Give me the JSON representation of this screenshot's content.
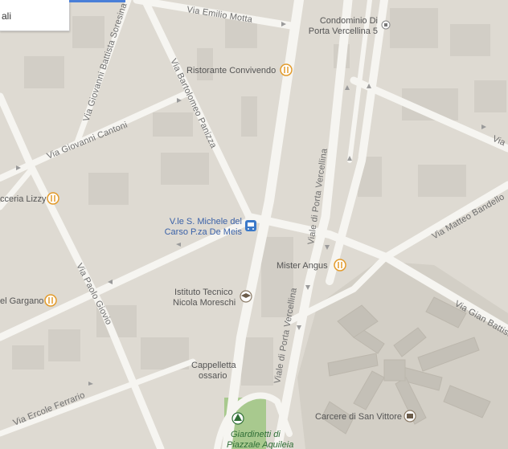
{
  "panel": {
    "partial_text": "ali"
  },
  "colors": {
    "road": "#f6f5f1",
    "block": "#d9d6ce",
    "background": "#dedad2",
    "park": "#a8c98e",
    "restaurant": "#e39b2b",
    "transit": "#3b79c9",
    "building": "#c6c2ba",
    "accent_bar": "#4a7fd8"
  },
  "streets": [
    {
      "id": "via-emilio-motta",
      "label": "Via Emilio Motta"
    },
    {
      "id": "via-giovanni-battista-soresina",
      "label": "Via Giovanni Battista Soresina"
    },
    {
      "id": "via-bartolomeo-panizza",
      "label": "Via Bartolomeo Panizza"
    },
    {
      "id": "via-giovanni-cantoni",
      "label": "Via Giovanni Cantoni"
    },
    {
      "id": "viale-di-porta-vercellina-1",
      "label": "Viale di Porta Vercellina"
    },
    {
      "id": "viale-di-porta-vercellina-2",
      "label": "Viale di Porta Vercellina"
    },
    {
      "id": "via-matteo-bandello",
      "label": "Via Matteo Bandello"
    },
    {
      "id": "via-gian-battista",
      "label": "Via Gian Battist"
    },
    {
      "id": "via-paolo-giovio",
      "label": "Via Paolo Giovio"
    },
    {
      "id": "via-ercole-ferrario",
      "label": "Via Ercole Ferrario"
    },
    {
      "id": "via-partial-right",
      "label": "Via"
    }
  ],
  "pois": [
    {
      "id": "condominio",
      "label_1": "Condominio Di",
      "label_2": "Porta Vercellina 5",
      "icon": "building-icon"
    },
    {
      "id": "ristorante-convivendo",
      "label_1": "Ristorante Convivendo",
      "icon": "restaurant-icon"
    },
    {
      "id": "pizzeria-lizzy",
      "label_1": "cceria Lizzy",
      "icon": "restaurant-icon"
    },
    {
      "id": "transit-stop",
      "label_1": "V.le S. Michele del",
      "label_2": "Carso P.za De Meis",
      "icon": "tram-icon"
    },
    {
      "id": "mister-angus",
      "label_1": "Mister Angus",
      "icon": "restaurant-icon"
    },
    {
      "id": "el-gargano",
      "label_1": "el Gargano",
      "icon": "restaurant-icon"
    },
    {
      "id": "istituto-tecnico",
      "label_1": "Istituto Tecnico",
      "label_2": "Nicola Moreschi",
      "icon": "school-icon"
    },
    {
      "id": "cappelletta",
      "label_1": "Cappelletta",
      "label_2": "ossario",
      "icon": ""
    },
    {
      "id": "carcere",
      "label_1": "Carcere di San Vittore",
      "icon": "landmark-icon"
    },
    {
      "id": "giardinetti",
      "label_1": "Giardinetti di",
      "label_2": "Piazzale Aquileia",
      "icon": "tree-icon"
    }
  ]
}
